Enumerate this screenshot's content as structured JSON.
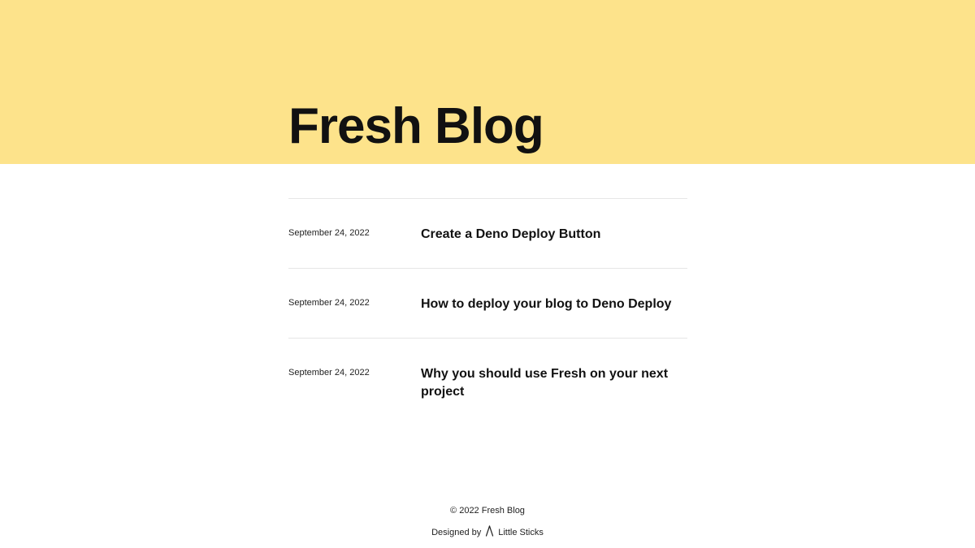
{
  "header": {
    "title": "Fresh Blog",
    "background_color": "#fde38b"
  },
  "posts": [
    {
      "date": "September 24, 2022",
      "title": "Create a Deno Deploy Button"
    },
    {
      "date": "September 24, 2022",
      "title": "How to deploy your blog to Deno Deploy"
    },
    {
      "date": "September 24, 2022",
      "title": "Why you should use Fresh on your next project"
    }
  ],
  "footer": {
    "copyright": "© 2022 Fresh Blog",
    "designed_by_label": "Designed by",
    "designer_icon": "little-sticks-icon",
    "designer_name": "Little Sticks"
  }
}
